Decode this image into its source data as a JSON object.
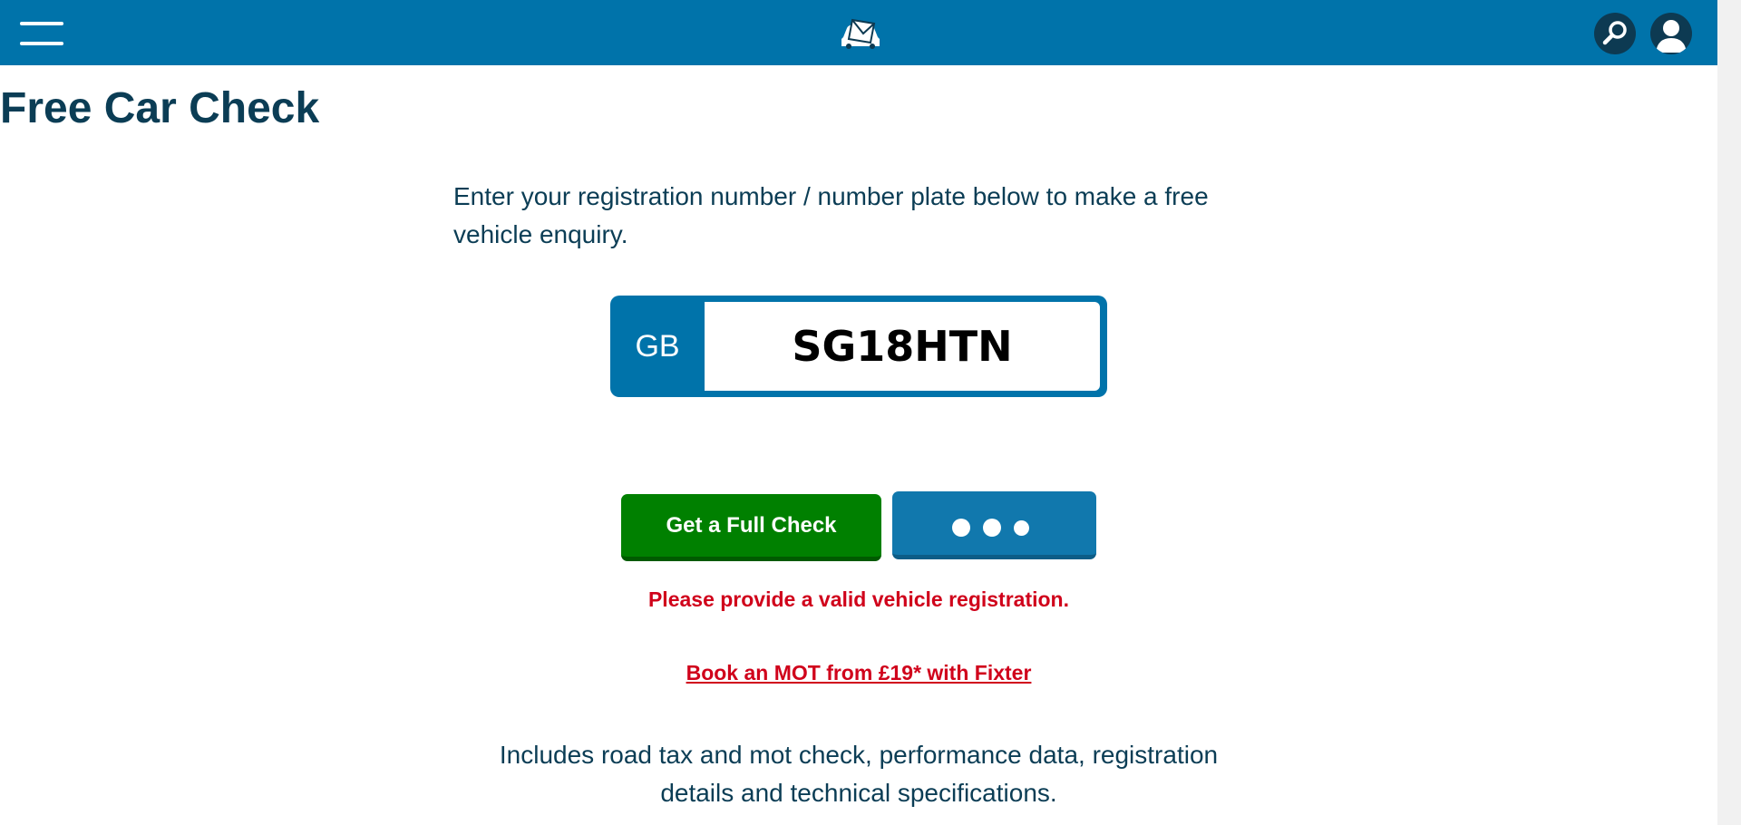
{
  "header": {
    "menu_icon": "hamburger-icon",
    "logo_icon": "car-mail-logo",
    "search_icon": "search-icon",
    "account_icon": "user-icon",
    "bg_color": "#0073aa"
  },
  "main": {
    "title": "Free Car Check",
    "intro": "Enter your registration number / number plate below to make a free vehicle enquiry.",
    "plate": {
      "country": "GB",
      "value": "SG18HTN"
    },
    "full_check_button": "Get a Full Check",
    "more_button_icon": "more-dots-icon",
    "error_message": "Please provide a valid vehicle registration.",
    "mot_link": "Book an MOT from £19* with Fixter",
    "includes_text": "Includes road tax and mot check, performance data, registration details and technical specifications."
  },
  "colors": {
    "primary": "#0073aa",
    "success": "#008000",
    "error": "#d0021b",
    "text": "#0b3d55"
  }
}
